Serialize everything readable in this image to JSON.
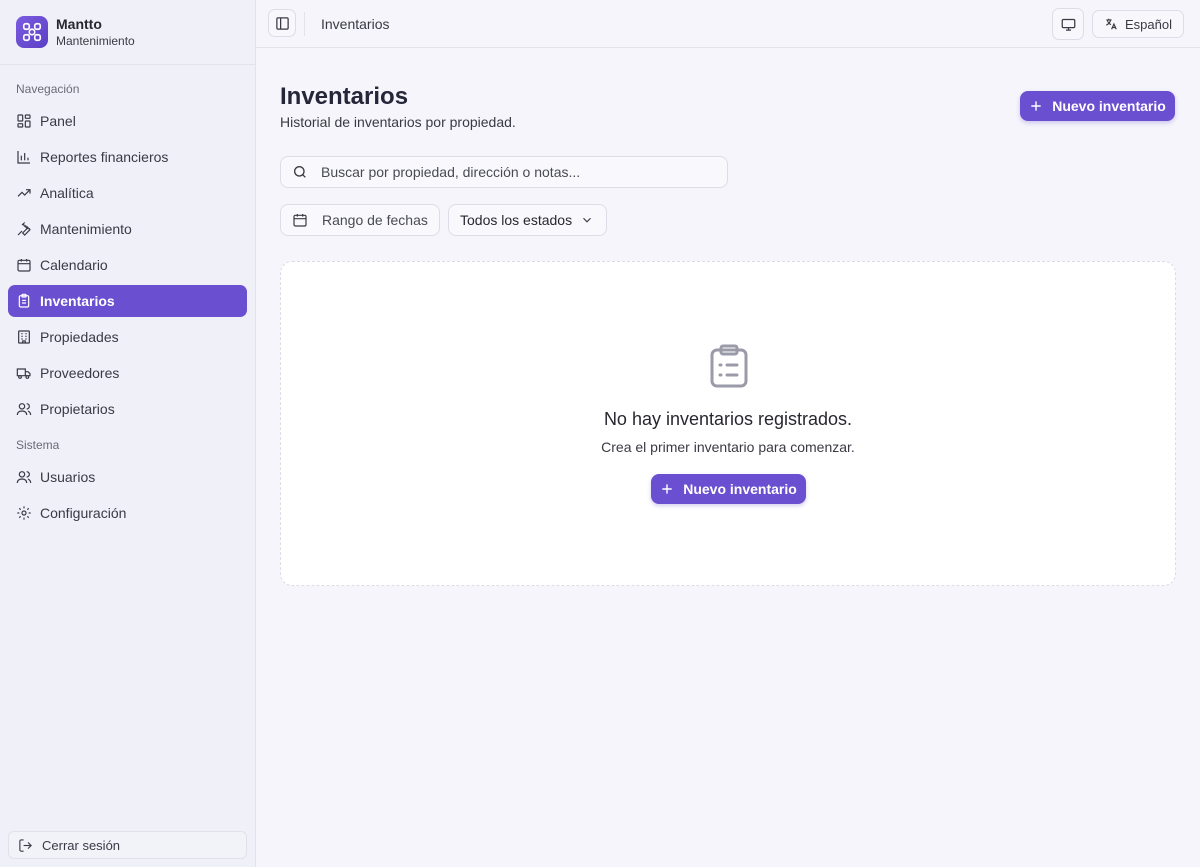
{
  "brand": {
    "name": "Mantto",
    "subtitle": "Mantenimiento",
    "logo_icon": "gear-network-icon"
  },
  "sidebar": {
    "section_nav": "Navegación",
    "nav_items": [
      {
        "label": "Panel",
        "icon": "grid-icon",
        "active": false
      },
      {
        "label": "Reportes financieros",
        "icon": "bar-chart-icon",
        "active": false
      },
      {
        "label": "Analítica",
        "icon": "trend-icon",
        "active": false
      },
      {
        "label": "Mantenimiento",
        "icon": "wrench-icon",
        "active": false
      },
      {
        "label": "Calendario",
        "icon": "calendar-icon",
        "active": false
      },
      {
        "label": "Inventarios",
        "icon": "clipboard-icon",
        "active": true
      },
      {
        "label": "Propiedades",
        "icon": "building-icon",
        "active": false
      },
      {
        "label": "Proveedores",
        "icon": "truck-icon",
        "active": false
      },
      {
        "label": "Propietarios",
        "icon": "users-icon",
        "active": false
      }
    ],
    "section_system": "Sistema",
    "system_items": [
      {
        "label": "Usuarios",
        "icon": "users-icon"
      },
      {
        "label": "Configuración",
        "icon": "gear-icon"
      }
    ],
    "logout_label": "Cerrar sesión"
  },
  "topbar": {
    "breadcrumb": "Inventarios",
    "language": "Español"
  },
  "page": {
    "title": "Inventarios",
    "subtitle": "Historial de inventarios por propiedad.",
    "new_button": "Nuevo inventario",
    "search_placeholder": "Buscar por propiedad, dirección o notas...",
    "date_filter": "Rango de fechas",
    "status_filter": "Todos los estados"
  },
  "empty_state": {
    "title": "No hay inventarios registrados.",
    "subtitle": "Crea el primer inventario para comenzar.",
    "button": "Nuevo inventario"
  },
  "colors": {
    "accent": "#6a4fd0",
    "background": "#f5f5fb",
    "sidebar": "#f0f0f8"
  }
}
